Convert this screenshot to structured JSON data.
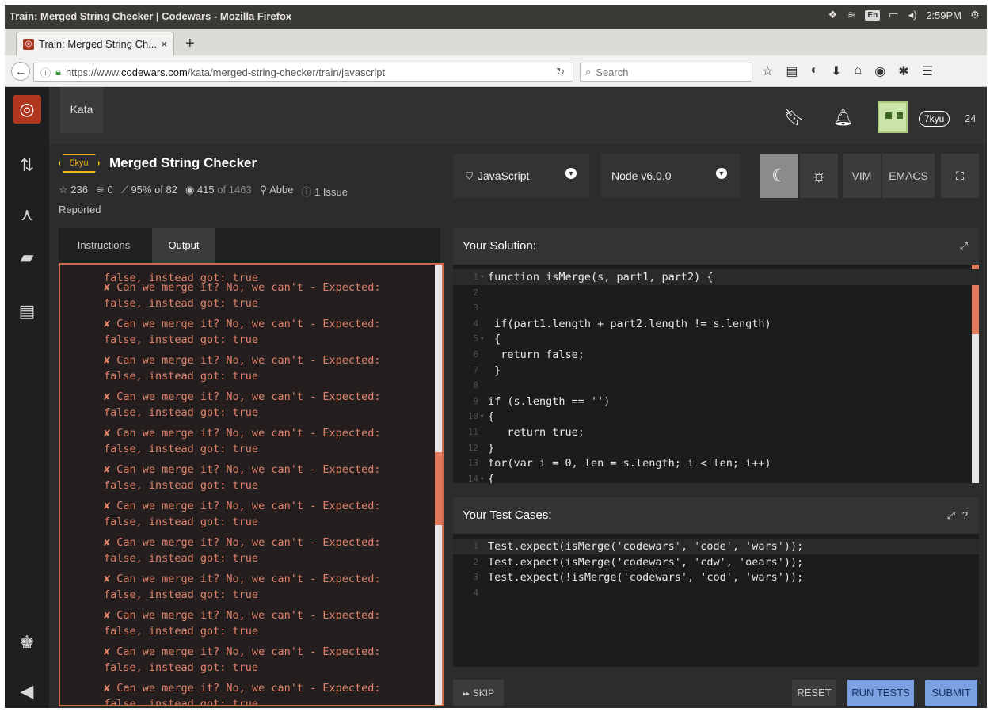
{
  "os": {
    "window_title": "Train: Merged String Checker | Codewars - Mozilla Firefox",
    "lang": "En",
    "time": "2:59PM"
  },
  "browser": {
    "tab_title": "Train: Merged String Ch...",
    "tab_close": "×",
    "new_tab": "+",
    "url_prefix": "https://www.",
    "url_domain": "codewars.com",
    "url_path": "/kata/merged-string-checker/train/javascript",
    "search_placeholder": "Search"
  },
  "topnav": {
    "kata_label": "Kata",
    "rank": "7kyu",
    "honor": "24"
  },
  "kata": {
    "rank": "5kyu",
    "title": "Merged String Checker",
    "stars": "☆ 236",
    "collections": "0",
    "satisfaction": "95% of 82",
    "completed_num": "415",
    "completed_of": "of 1463",
    "author": "Abbe",
    "issues": "1 Issue",
    "reported": "Reported"
  },
  "left_tabs": {
    "instructions": "Instructions",
    "output": "Output"
  },
  "output": {
    "first_line": "false, instead got: true",
    "fail_line1": "✘ Can we merge it? No, we can't - Expected:",
    "fail_line2": "false, instead got: true"
  },
  "controls": {
    "language": "JavaScript",
    "version": "Node v6.0.0",
    "vim": "VIM",
    "emacs": "EMACS"
  },
  "solution": {
    "title": "Your Solution:",
    "lines": [
      {
        "n": "1",
        "fold": "▾",
        "code": "function isMerge(s, part1, part2) {"
      },
      {
        "n": "2",
        "fold": "",
        "code": ""
      },
      {
        "n": "3",
        "fold": "",
        "code": ""
      },
      {
        "n": "4",
        "fold": "",
        "code": " if(part1.length + part2.length != s.length)"
      },
      {
        "n": "5",
        "fold": "▾",
        "code": " {"
      },
      {
        "n": "6",
        "fold": "",
        "code": "  return false;"
      },
      {
        "n": "7",
        "fold": "",
        "code": " }"
      },
      {
        "n": "8",
        "fold": "",
        "code": ""
      },
      {
        "n": "9",
        "fold": "",
        "code": "if (s.length == '')"
      },
      {
        "n": "10",
        "fold": "▾",
        "code": "{"
      },
      {
        "n": "11",
        "fold": "",
        "code": "   return true;"
      },
      {
        "n": "12",
        "fold": "",
        "code": "}"
      },
      {
        "n": "13",
        "fold": "",
        "code": "for(var i = 0, len = s.length; i < len; i++)"
      },
      {
        "n": "14",
        "fold": "▾",
        "code": "{"
      }
    ]
  },
  "tests": {
    "title": "Your Test Cases:",
    "lines": [
      {
        "n": "1",
        "code": "Test.expect(isMerge('codewars', 'code', 'wars'));"
      },
      {
        "n": "2",
        "code": "Test.expect(isMerge('codewars', 'cdw', 'oears'));"
      },
      {
        "n": "3",
        "code": "Test.expect(!isMerge('codewars', 'cod', 'wars'));"
      },
      {
        "n": "4",
        "code": ""
      }
    ]
  },
  "buttons": {
    "skip": "SKIP",
    "reset": "RESET",
    "run": "RUN TESTS",
    "submit": "SUBMIT"
  }
}
